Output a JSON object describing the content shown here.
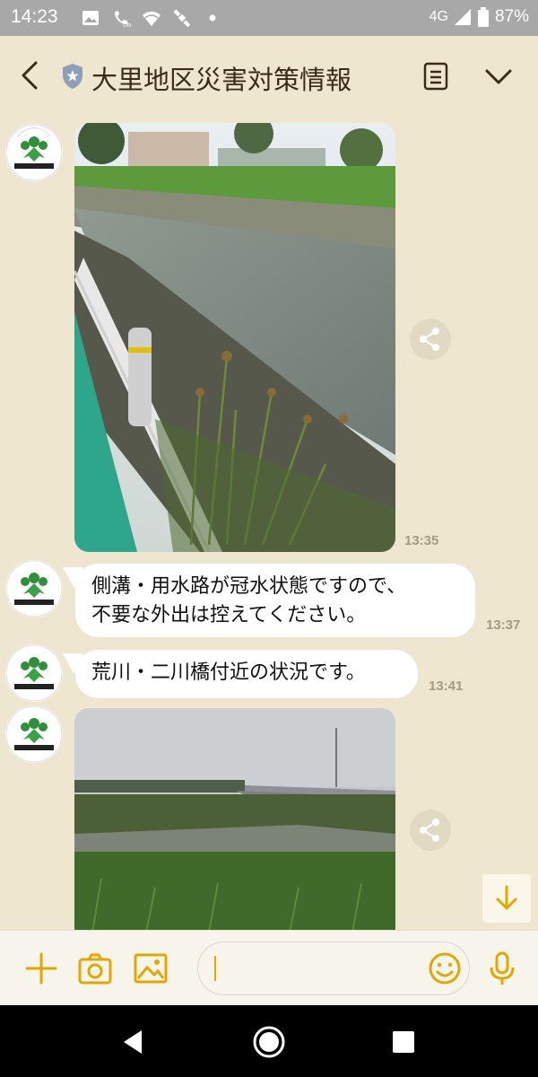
{
  "status_bar": {
    "time": "14:23",
    "network": "4G",
    "battery": "87%",
    "icons": [
      "gallery-icon",
      "wifi-calling-icon",
      "wifi-icon",
      "satellite-icon",
      "dot-icon",
      "signal-icon",
      "battery-icon"
    ]
  },
  "header": {
    "title": "大里地区災害対策情報",
    "icons": [
      "back-icon",
      "official-shield-icon",
      "notes-icon",
      "chevron-down-icon"
    ]
  },
  "messages": [
    {
      "type": "photo",
      "time": "13:35",
      "description_icon": "share-icon"
    },
    {
      "type": "text",
      "lines": [
        "側溝・用水路が冠水状態ですので、",
        "不要な外出は控えてください。"
      ],
      "time": "13:37"
    },
    {
      "type": "text",
      "lines": [
        "荒川・二川橋付近の状況です。"
      ],
      "time": "13:41"
    },
    {
      "type": "photo",
      "time": "",
      "description_icon": "share-icon"
    }
  ],
  "input": {
    "value": "",
    "icons": [
      "plus-icon",
      "camera-icon",
      "image-icon",
      "emoji-icon",
      "microphone-icon"
    ]
  },
  "colors": {
    "background": "#efe6cf",
    "accent": "#e0a800",
    "statusbar": "#a8a8a8",
    "title": "#3a2c19"
  }
}
